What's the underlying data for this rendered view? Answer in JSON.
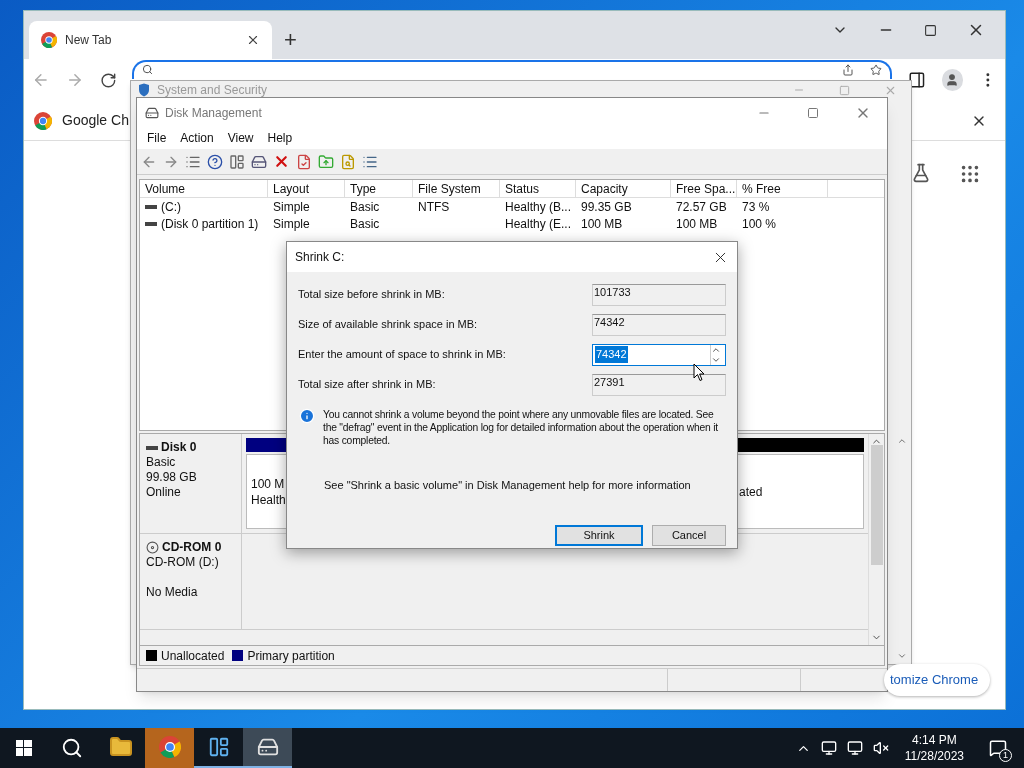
{
  "chrome": {
    "tabs": [
      {
        "title": "New Tab",
        "selected": true
      }
    ],
    "new_tab": "+",
    "promo": "Google Ch",
    "customize": "tomize Chrome"
  },
  "back_window": {
    "title": "System and Security"
  },
  "disk_management": {
    "title": "Disk Management",
    "menu": [
      "File",
      "Action",
      "View",
      "Help"
    ],
    "columns": [
      "Volume",
      "Layout",
      "Type",
      "File System",
      "Status",
      "Capacity",
      "Free Spa...",
      "% Free"
    ],
    "rows": [
      [
        "(C:)",
        "Simple",
        "Basic",
        "NTFS",
        "Healthy (B...",
        "99.35 GB",
        "72.57 GB",
        "73 %"
      ],
      [
        "(Disk 0 partition 1)",
        "Simple",
        "Basic",
        "",
        "Healthy (E...",
        "100 MB",
        "100 MB",
        "100 %"
      ]
    ],
    "disks": [
      {
        "kind": "disk",
        "name": "Disk 0",
        "lines": [
          "Basic",
          "99.98 GB",
          "Online"
        ],
        "partitions": [
          {
            "lines": [
              "100 M",
              "Health"
            ],
            "color": "#000080"
          },
          {
            "lines": [
              "ated"
            ],
            "color": "#000000"
          }
        ]
      },
      {
        "kind": "cdrom",
        "name": "CD-ROM 0",
        "lines": [
          "CD-ROM (D:)",
          "No Media"
        ]
      }
    ],
    "legend": [
      {
        "label": "Unallocated",
        "color": "#000000"
      },
      {
        "label": "Primary partition",
        "color": "#000080"
      }
    ]
  },
  "dialog": {
    "title": "Shrink C:",
    "fields": [
      {
        "label": "Total size before shrink in MB:",
        "value": "101733",
        "kind": "readonly"
      },
      {
        "label": "Size of available shrink space in MB:",
        "value": "74342",
        "kind": "readonly"
      },
      {
        "label": "Enter the amount of space to shrink in MB:",
        "value": "74342",
        "kind": "spin",
        "text_selected": true
      },
      {
        "label": "Total size after shrink in MB:",
        "value": "27391",
        "kind": "readonly"
      }
    ],
    "info": "You cannot shrink a volume beyond the point where any unmovable files are located. See the \"defrag\" event in the Application log for detailed information about the operation when it has completed.",
    "help": "See \"Shrink a basic volume\" in Disk Management help for more information",
    "buttons": [
      {
        "label": "Shrink",
        "default": true
      },
      {
        "label": "Cancel",
        "default": false
      }
    ]
  },
  "taskbar": {
    "apps": [
      {
        "kind": "folder",
        "running": false,
        "attention": false,
        "selected": false
      },
      {
        "kind": "chrome",
        "running": false,
        "attention": true,
        "selected": false
      },
      {
        "kind": "control-panel",
        "running": true,
        "attention": false,
        "selected": false
      },
      {
        "kind": "disk-management",
        "running": true,
        "attention": false,
        "selected": true
      }
    ],
    "time": "4:14 PM",
    "date": "11/28/2023",
    "notifications": "1"
  }
}
